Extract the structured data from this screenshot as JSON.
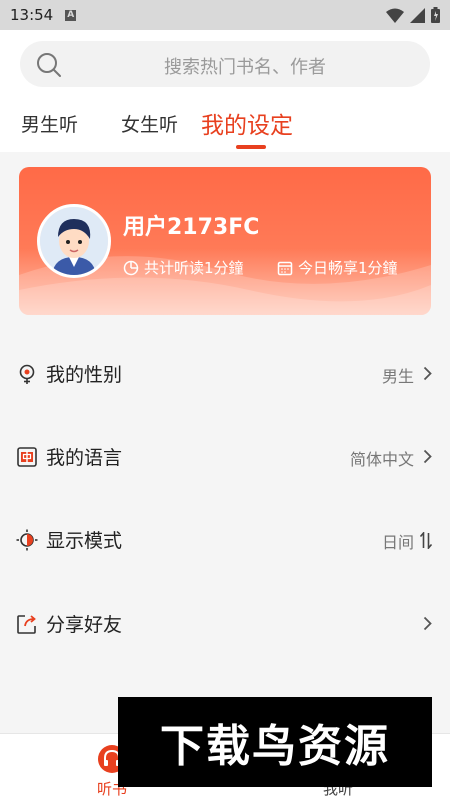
{
  "status_bar": {
    "time": "13:54",
    "notification_glyph": "A"
  },
  "search": {
    "placeholder": "搜索热门书名、作者"
  },
  "tabs": [
    {
      "label": "男生听",
      "active": false
    },
    {
      "label": "女生听",
      "active": false
    },
    {
      "label": "我的设定",
      "active": true
    }
  ],
  "profile": {
    "username": "用户2173FC",
    "total_listen": "共计听读1分鐘",
    "today_enjoy": "今日畅享1分鐘"
  },
  "settings": [
    {
      "label": "我的性别",
      "value": "男生",
      "icon": "gender-icon",
      "control": "chevron"
    },
    {
      "label": "我的语言",
      "value": "简体中文",
      "icon": "language-icon",
      "control": "chevron"
    },
    {
      "label": "显示模式",
      "value": "日间",
      "icon": "display-mode-icon",
      "control": "swap"
    },
    {
      "label": "分享好友",
      "value": "",
      "icon": "share-icon",
      "control": "chevron"
    }
  ],
  "bottom_nav": [
    {
      "label": "听书",
      "active": true
    },
    {
      "label": "我听",
      "active": false
    }
  ],
  "watermark": {
    "text": "下载鸟资源"
  },
  "colors": {
    "accent": "#e8401f",
    "card_top": "#ff6a47",
    "card_bottom": "#ffc6b4"
  }
}
